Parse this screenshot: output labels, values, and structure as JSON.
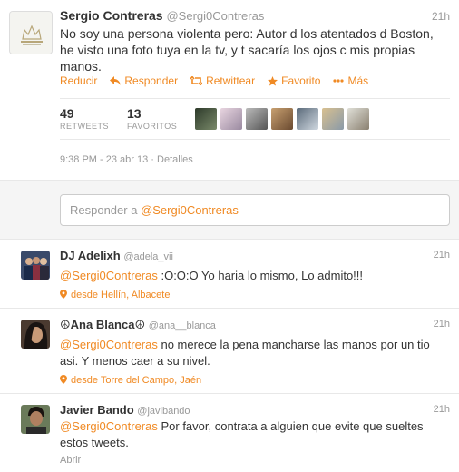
{
  "main_tweet": {
    "fullname": "Sergio Contreras",
    "username": "@Sergi0Contreras",
    "time": "21h",
    "text": "No soy una persona violenta pero: Autor d los atentados d Boston, he visto una foto tuya en la tv, y t sacaría los ojos c mis propias manos.",
    "actions": {
      "collapse": "Reducir",
      "reply": "Responder",
      "retweet": "Retwittear",
      "favorite": "Favorito",
      "more": "Más"
    },
    "retweets_count": "49",
    "retweets_label": "RETWEETS",
    "favorites_count": "13",
    "favorites_label": "FAVORITOS",
    "datetime": "9:38 PM - 23 abr 13",
    "details_sep": "·",
    "details": "Detalles"
  },
  "reply_box": {
    "prefix": "Responder a ",
    "mention": "@Sergi0Contreras"
  },
  "replies": [
    {
      "fullname": "DJ Adelixh",
      "username": "@adela_vii",
      "time": "21h",
      "mention": "@Sergi0Contreras",
      "text": " :O:O:O Yo haria lo mismo, Lo admito!!!",
      "location": "desde Hellín, Albacete"
    },
    {
      "fullname": "☮Ana Blanca☮",
      "username": "@ana__blanca",
      "time": "21h",
      "mention": "@Sergi0Contreras",
      "text": " no merece la pena mancharse las manos por un tio asi. Y menos caer a su nivel.",
      "location": "desde Torre del Campo, Jaén"
    },
    {
      "fullname": "Javier Bando",
      "username": "@javibando",
      "time": "21h",
      "mention": "@Sergi0Contreras",
      "text": " Por favor, contrata a alguien que evite que sueltes estos tweets.",
      "open": "Abrir"
    }
  ],
  "colors": {
    "accent": "#f08a24",
    "muted": "#999999",
    "text": "#333333"
  }
}
